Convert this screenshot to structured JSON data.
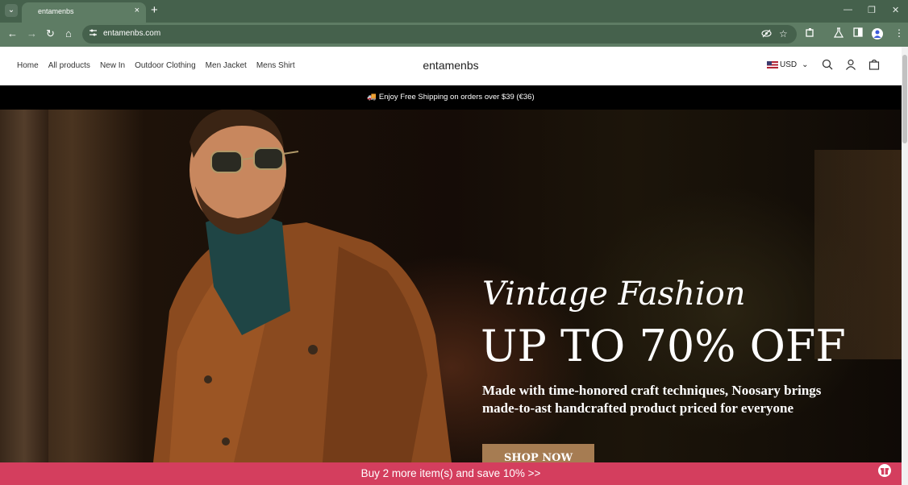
{
  "browser": {
    "tab_title": "entamenbs",
    "url": "entamenbs.com",
    "tab_close": "×",
    "new_tab": "+",
    "window_controls": {
      "minimize": "—",
      "maximize": "❐",
      "close": "✕"
    },
    "nav": {
      "back": "←",
      "forward": "→",
      "reload": "↻",
      "home": "⌂"
    },
    "tab_menu": "⌄"
  },
  "site": {
    "logo": "entamenbs",
    "nav_items": [
      "Home",
      "All products",
      "New In",
      "Outdoor Clothing",
      "Men Jacket",
      "Mens Shirt"
    ],
    "currency": "USD",
    "currency_chevron": "⌄",
    "announcement": "🚚 Enjoy Free Shipping on orders over $39  (€36)"
  },
  "hero": {
    "script_title": "Vintage Fashion",
    "headline": "UP TO 70% OFF",
    "subtext": "Made with time-honored craft techniques, Noosary brings made-to-ast handcrafted product priced for everyone",
    "cta": "SHOP NOW"
  },
  "promo": {
    "text": "Buy 2 more item(s) and save 10%  >>"
  },
  "colors": {
    "chrome_dark": "#45614c",
    "chrome_light": "#5e7c64",
    "announce_bg": "#000000",
    "cta_bg": "#a67c52",
    "promo_bg": "#d43e5e"
  },
  "icons": [
    "tune-icon",
    "eye-off-icon",
    "star-icon",
    "extensions-icon",
    "flask-icon",
    "sidebar-icon",
    "profile-icon",
    "more-icon",
    "search-icon",
    "user-icon",
    "bag-icon",
    "gift-icon"
  ]
}
